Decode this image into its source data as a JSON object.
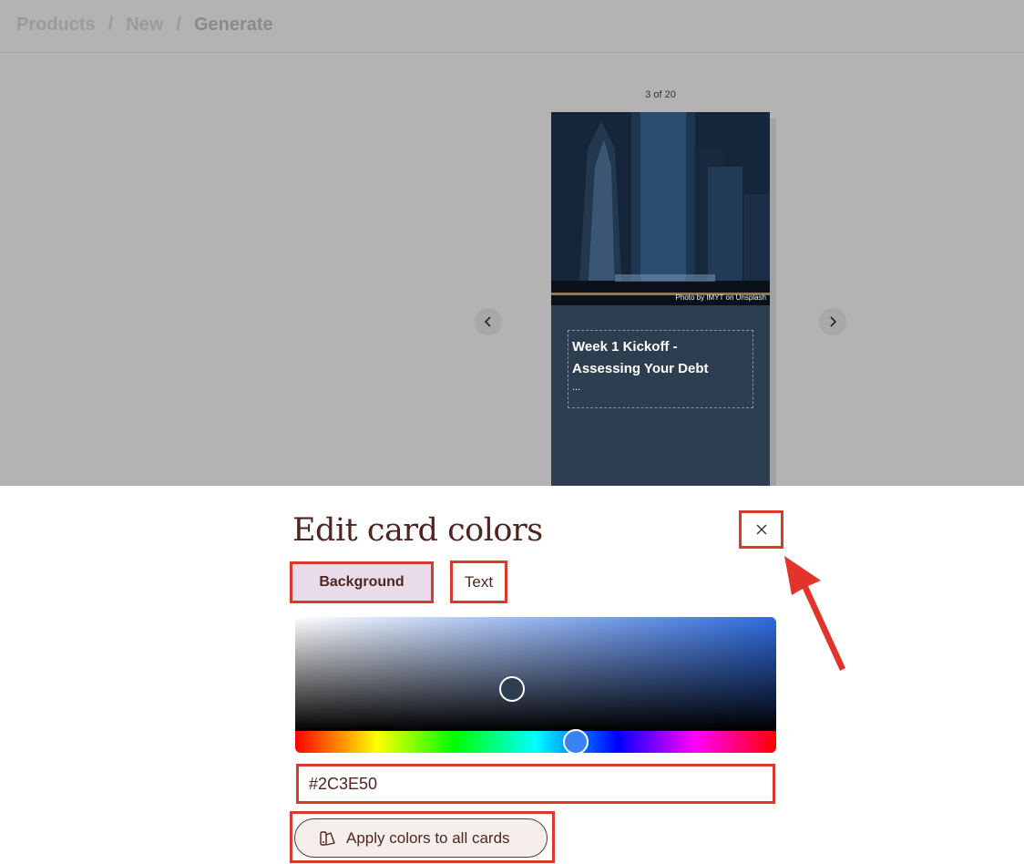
{
  "breadcrumb": {
    "items": [
      "Products",
      "New",
      "Generate"
    ],
    "separator": "/"
  },
  "carousel": {
    "counter": "3 of 20"
  },
  "card": {
    "photo_credit": "Photo by IMYT on Unsplash",
    "title_line1": "Week 1 Kickoff -",
    "title_line2": "Assessing Your Debt",
    "ellipsis": "..."
  },
  "panel": {
    "title": "Edit card colors",
    "tabs": {
      "background": "Background",
      "text": "Text"
    },
    "hex_value": "#2C3E50",
    "apply_label": "Apply colors to all cards"
  },
  "colors": {
    "selected": "#2C3E50",
    "annotation": "#d93a2b",
    "card_bg": "#2c3e50"
  },
  "icons": {
    "close": "close-icon",
    "prev": "chevron-left-icon",
    "next": "chevron-right-icon",
    "apply": "palette-icon"
  }
}
